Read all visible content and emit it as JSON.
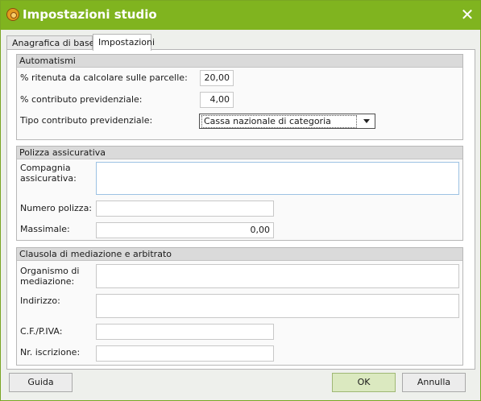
{
  "window": {
    "title": "Impostazioni studio",
    "icon": "app-logo-icon",
    "close": "✕"
  },
  "tabs": [
    {
      "label": "Anagrafica di base",
      "active": false
    },
    {
      "label": "Impostazioni",
      "active": true
    }
  ],
  "automatismi": {
    "header": "Automatismi",
    "ritenuta_label": "% ritenuta da calcolare sulle parcelle:",
    "ritenuta_value": "20,00",
    "contributo_label": "% contributo previdenziale:",
    "contributo_value": "4,00",
    "tipo_label": "Tipo contributo previdenziale:",
    "tipo_value": "Cassa nazionale di categoria"
  },
  "polizza": {
    "header": "Polizza assicurativa",
    "compagnia_label_1": "Compagnia",
    "compagnia_label_2": "assicurativa:",
    "compagnia_value": "",
    "numero_label": "Numero polizza:",
    "numero_value": "",
    "massimale_label": "Massimale:",
    "massimale_value": "0,00"
  },
  "clausola": {
    "header": "Clausola di mediazione e arbitrato",
    "organismo_label_1": "Organismo di",
    "organismo_label_2": "mediazione:",
    "organismo_value": "",
    "indirizzo_label": "Indirizzo:",
    "indirizzo_value": "",
    "cf_label": "C.F./P.IVA:",
    "cf_value": "",
    "iscrizione_label": "Nr. iscrizione:",
    "iscrizione_value": ""
  },
  "buttons": {
    "guida": "Guida",
    "ok": "OK",
    "annulla": "Annulla"
  },
  "colors": {
    "titlebar": "#80b41f",
    "ok_button": "#dbe9c0"
  }
}
